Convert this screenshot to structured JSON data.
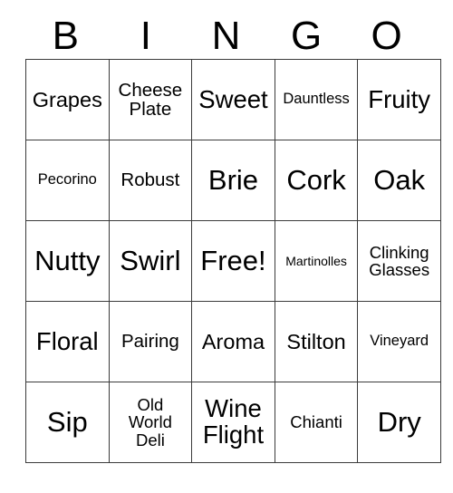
{
  "card": {
    "header": {
      "letters": [
        "B",
        "I",
        "N",
        "G",
        "O"
      ]
    },
    "rows": [
      [
        {
          "label": "Grapes",
          "size": "fs-24"
        },
        {
          "label": "Cheese\nPlate",
          "size": "fs-21"
        },
        {
          "label": "Sweet",
          "size": "fs-28"
        },
        {
          "label": "Dauntless",
          "size": "fs-17"
        },
        {
          "label": "Fruity",
          "size": "fs-28"
        }
      ],
      [
        {
          "label": "Pecorino",
          "size": "fs-17"
        },
        {
          "label": "Robust",
          "size": "fs-21"
        },
        {
          "label": "Brie",
          "size": "fs-32"
        },
        {
          "label": "Cork",
          "size": "fs-32"
        },
        {
          "label": "Oak",
          "size": "fs-32"
        }
      ],
      [
        {
          "label": "Nutty",
          "size": "fs-32"
        },
        {
          "label": "Swirl",
          "size": "fs-32"
        },
        {
          "label": "Free!",
          "size": "fs-32"
        },
        {
          "label": "Martinolles",
          "size": "fs-14"
        },
        {
          "label": "Clinking\nGlasses",
          "size": "fs-19"
        }
      ],
      [
        {
          "label": "Floral",
          "size": "fs-28"
        },
        {
          "label": "Pairing",
          "size": "fs-21"
        },
        {
          "label": "Aroma",
          "size": "fs-24"
        },
        {
          "label": "Stilton",
          "size": "fs-24"
        },
        {
          "label": "Vineyard",
          "size": "fs-17"
        }
      ],
      [
        {
          "label": "Sip",
          "size": "fs-32"
        },
        {
          "label": "Old\nWorld\nDeli",
          "size": "fs-19"
        },
        {
          "label": "Wine\nFlight",
          "size": "fs-28"
        },
        {
          "label": "Chianti",
          "size": "fs-19"
        },
        {
          "label": "Dry",
          "size": "fs-32"
        }
      ]
    ],
    "colors": {
      "border": "#3b3b3b",
      "text": "#000000",
      "background": "#ffffff"
    }
  }
}
